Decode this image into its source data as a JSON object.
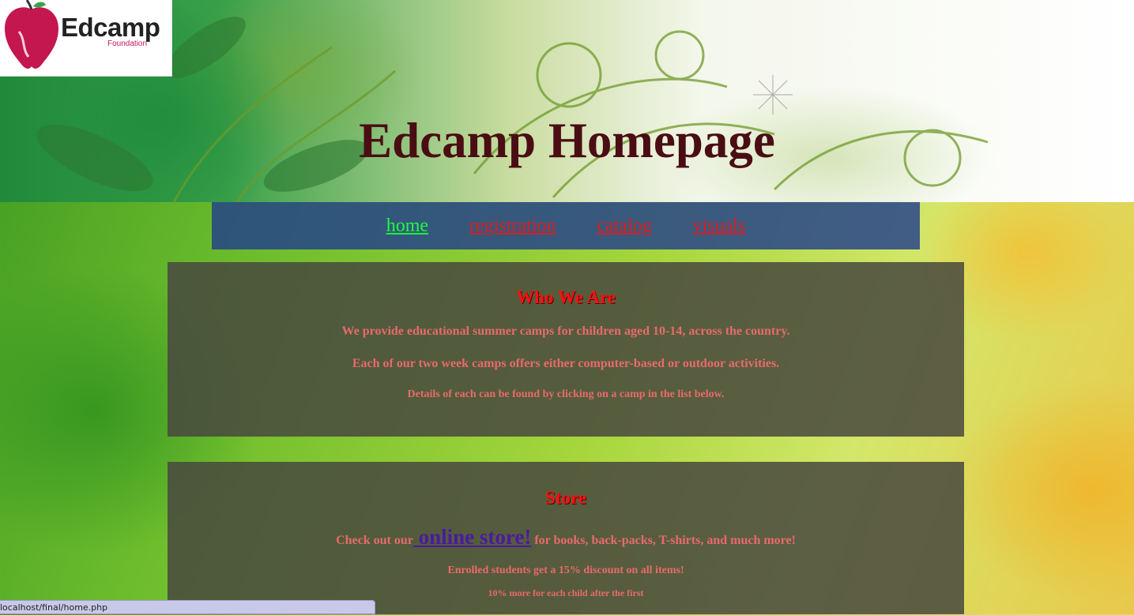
{
  "logo": {
    "name": "Edcamp",
    "subtitle": "Foundation",
    "icon": "apple-icon"
  },
  "header": {
    "title": "Edcamp Homepage"
  },
  "nav": {
    "items": [
      {
        "label": "home",
        "active": true
      },
      {
        "label": "registration",
        "active": false
      },
      {
        "label": "catalog",
        "active": false
      },
      {
        "label": "visuals",
        "active": false
      }
    ]
  },
  "who_we_are": {
    "heading": "Who We Are",
    "line1": "We provide educational summer camps for children aged 10-14, across the country.",
    "line2": "Each of our two week camps offers either computer-based or outdoor activities.",
    "line3": "Details of each can be found by clicking on a camp in the list below."
  },
  "store": {
    "heading": "Store",
    "intro_before": "Check out our",
    "link_text": " online store!",
    "intro_after": " for books, back-packs, T-shirts, and much more!",
    "discount": "Enrolled students get a 15% discount on all items!",
    "extra": "10% more for each child after the first"
  },
  "status_bar": {
    "url": "localhost/final/home.php"
  },
  "colors": {
    "title": "#4a0d14",
    "nav_active": "#1bff3a",
    "nav_link": "#e21b1b",
    "panel_heading": "#ff1010",
    "panel_text": "#e86a6a",
    "store_link": "#4a1aa0"
  }
}
